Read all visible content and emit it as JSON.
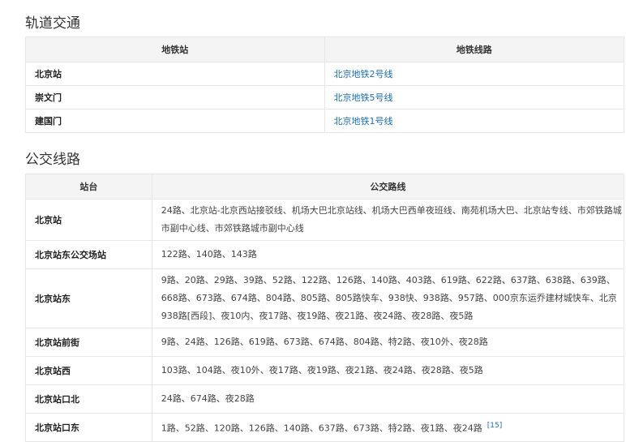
{
  "rail": {
    "title": "轨道交通",
    "headers": [
      "地铁站",
      "地铁线路"
    ],
    "rows": [
      {
        "station": "北京站",
        "line": "北京地铁2号线"
      },
      {
        "station": "崇文门",
        "line": "北京地铁5号线"
      },
      {
        "station": "建国门",
        "line": "北京地铁1号线"
      }
    ]
  },
  "bus": {
    "title": "公交线路",
    "headers": [
      "站台",
      "公交路线"
    ],
    "rows": [
      {
        "stop": "北京站",
        "routes": "24路、北京站-北京西站接驳线、机场大巴北京站线、机场大巴西单夜班线、南苑机场大巴、北京站专线、市郊铁路城市副中心线、市郊铁路城市副中心线"
      },
      {
        "stop": "北京站东公交场站",
        "routes": "122路、140路、143路"
      },
      {
        "stop": "北京站东",
        "routes": "9路、20路、29路、39路、52路、122路、126路、140路、403路、619路、622路、637路、638路、639路、668路、673路、674路、804路、805路、805路快车、938快、938路、957路、000京东运乔建材城快车、北京938路[西段]、夜10内、夜17路、夜19路、夜21路、夜24路、夜28路、夜5路"
      },
      {
        "stop": "北京站前街",
        "routes": "9路、24路、126路、619路、673路、674路、804路、特2路、夜10外、夜28路"
      },
      {
        "stop": "北京站西",
        "routes": "103路、104路、夜10外、夜17路、夜19路、夜21路、夜24路、夜28路、夜5路"
      },
      {
        "stop": "北京站口北",
        "routes": "24路、674路、夜28路"
      },
      {
        "stop": "北京站口东",
        "routes": "1路、52路、120路、126路、140路、637路、673路、特2路、夜1路、夜24路"
      }
    ],
    "reference": "[15]"
  }
}
